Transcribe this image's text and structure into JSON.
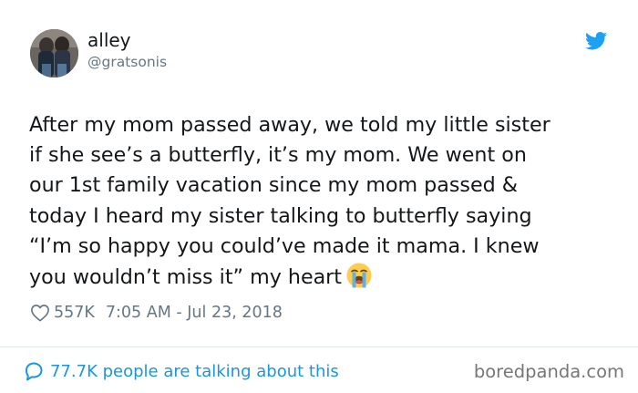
{
  "author": {
    "name": "alley",
    "handle": "@gratsonis"
  },
  "tweet": {
    "lines": [
      "After my mom passed away, we told my little sister",
      "if she see’s a butterfly, it’s my mom. We went on",
      "our 1st family vacation since my mom passed &",
      "today I heard my sister talking to butterfly saying",
      "“I’m so happy you could’ve made it mama. I knew",
      "you wouldn’t miss it” my heart"
    ],
    "emoji": "loudly-crying-face-icon"
  },
  "meta": {
    "likes": "557K",
    "timestamp": "7:05 AM - Jul 23, 2018"
  },
  "footer": {
    "conversation_text": "77.7K people are talking about this"
  },
  "watermark": "boredpanda.com",
  "icons": {
    "platform": "twitter-bird-icon",
    "like": "heart-outline-icon",
    "reply": "speech-bubble-icon"
  },
  "colors": {
    "twitter_blue": "#1da1f2",
    "link_blue": "#1b95e0",
    "secondary_text": "#657786",
    "primary_text": "#14171a"
  }
}
